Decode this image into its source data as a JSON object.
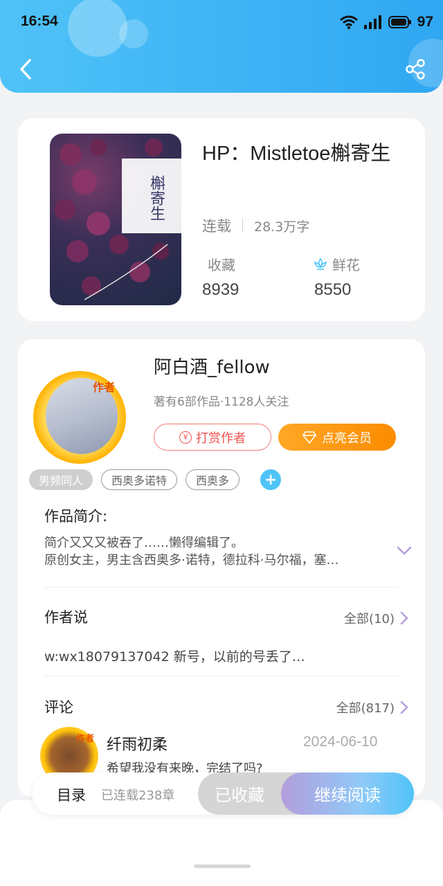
{
  "status_bar": {
    "time": "16:54",
    "battery": "97"
  },
  "book": {
    "cover_title": "槲寄生",
    "title": "HP：Mistletoe槲寄生",
    "status": "连载",
    "word_count": "28.3万字",
    "collect_label": "收藏",
    "collect_count": "8939",
    "flower_label": "鲜花",
    "flower_count": "8550"
  },
  "author": {
    "badge": "作者",
    "name": "阿白酒_fellow",
    "info": "著有6部作品·1128人关注",
    "reward_button": "打赏作者",
    "vip_button": "点亮会员"
  },
  "tags": [
    "男频同人",
    "西奥多诺特",
    "西奥多"
  ],
  "intro": {
    "title": "作品简介:",
    "line1": "简介又又又被吞了……懒得编辑了。",
    "line2": "原创女主，男主含西奥多·诺特，德拉科·马尔福，塞…"
  },
  "author_say": {
    "title": "作者说",
    "more": "全部(10)",
    "text": "w:wx18079137042 新号，以前的号丢了…"
  },
  "comments": {
    "title": "评论",
    "more": "全部(817)",
    "first": {
      "badge": "作者",
      "user": "纤雨初柔",
      "date": "2024-06-10",
      "text": "希望我没有来晚，完结了吗?"
    }
  },
  "bottom_bar": {
    "toc": "目录",
    "toc_count": "已连载238章",
    "collected": "已收藏",
    "continue_read": "继续阅读"
  },
  "colors": {
    "accent": "#4fc3f7",
    "vip": "#fb8c00",
    "reward": "#ef5350"
  }
}
